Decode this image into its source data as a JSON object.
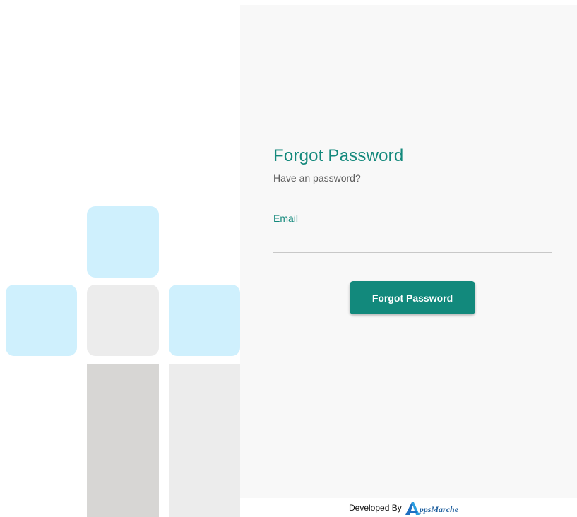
{
  "form": {
    "title": "Forgot Password",
    "subtitle": "Have an password?",
    "email_label": "Email",
    "email_value": "",
    "submit_label": "Forgot Password"
  },
  "footer": {
    "developed_by": "Developed By",
    "logo_text": "AppsMarche"
  },
  "colors": {
    "accent": "#12897c",
    "tile_blue": "#cff0fd",
    "tile_grey": "#ececec",
    "column_dark": "#d7d6d4",
    "panel_bg": "#f8f8f8"
  }
}
